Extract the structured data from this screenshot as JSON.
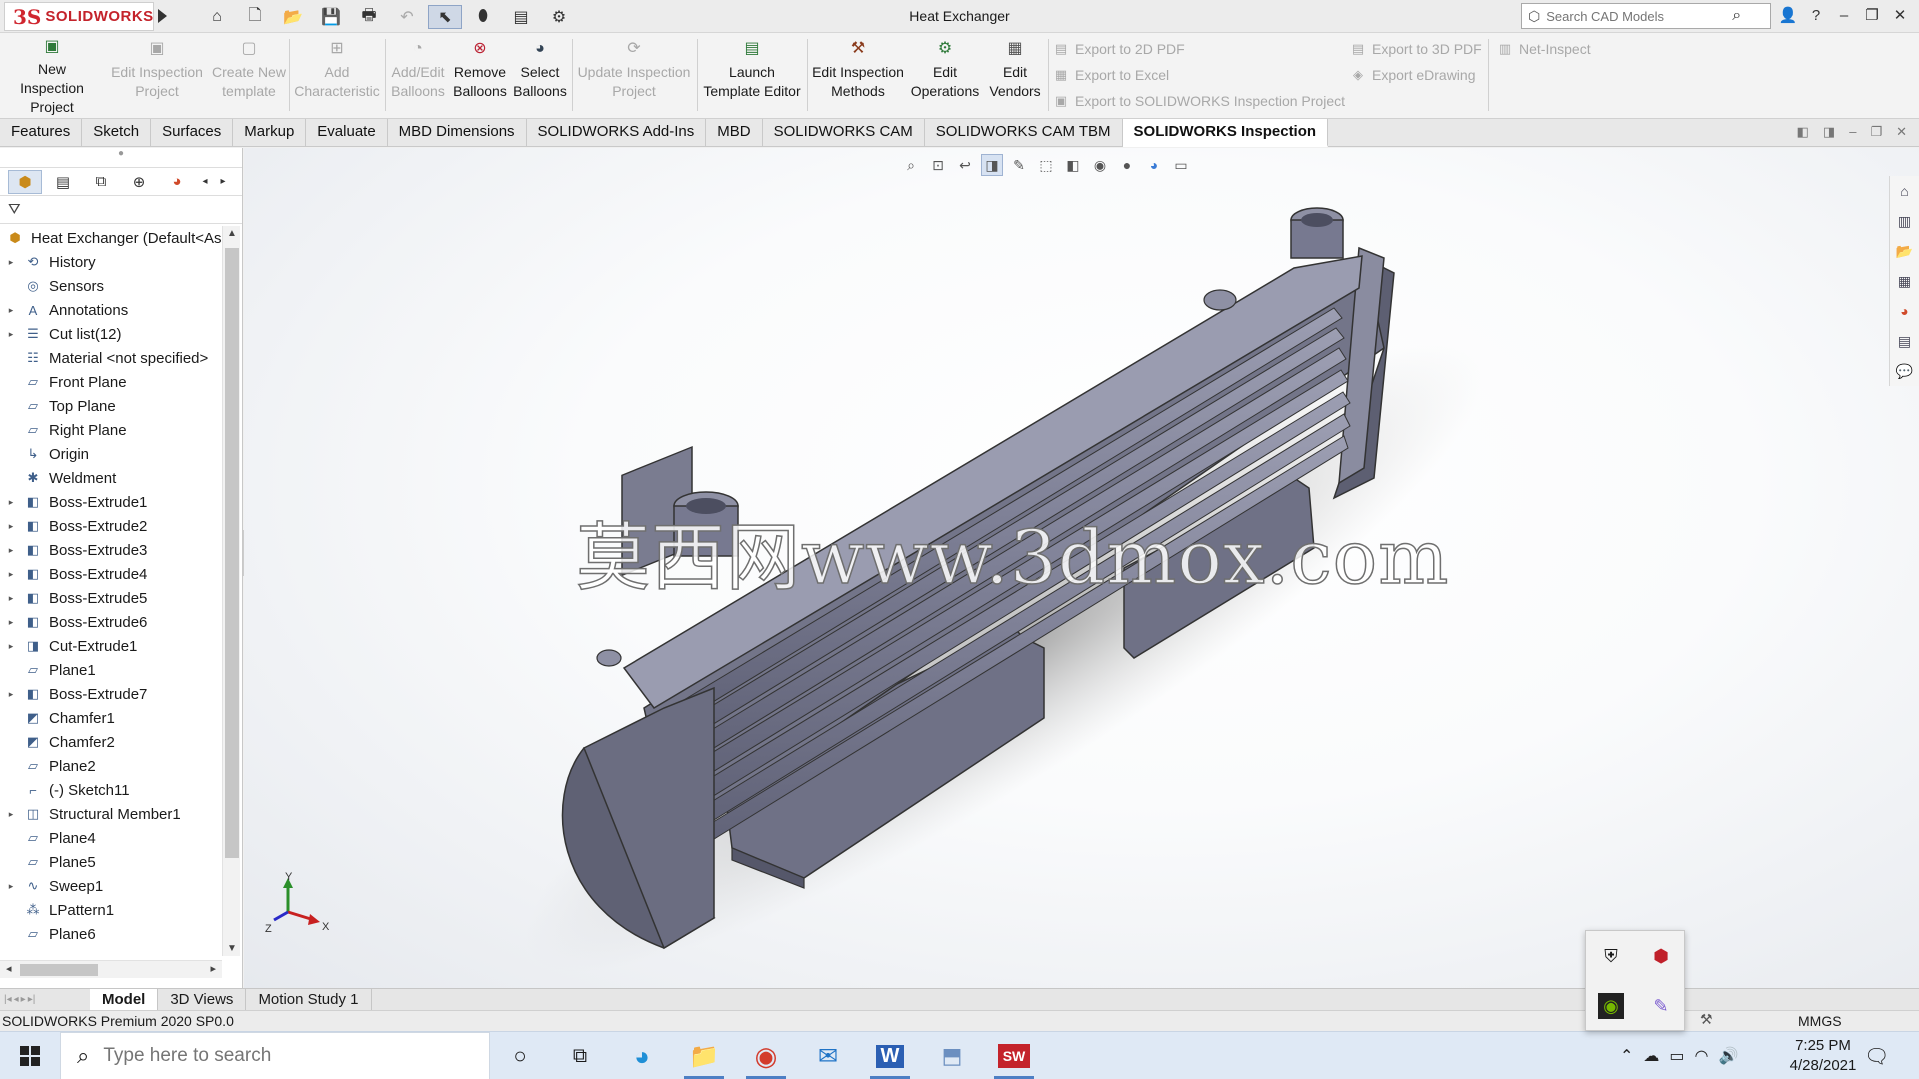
{
  "window": {
    "title": "Heat Exchanger",
    "logo_text": "SOLIDWORKS",
    "search_placeholder": "Search CAD Models"
  },
  "ribbon": {
    "buttons": [
      {
        "label1": "New Inspection",
        "label2": "Project",
        "enabled": true
      },
      {
        "label1": "Edit Inspection",
        "label2": "Project",
        "enabled": false
      },
      {
        "label1": "Create New",
        "label2": "template",
        "enabled": false
      },
      {
        "label1": "Add",
        "label2": "Characteristic",
        "enabled": false
      },
      {
        "label1": "Add/Edit",
        "label2": "Balloons",
        "enabled": false
      },
      {
        "label1": "Remove",
        "label2": "Balloons",
        "enabled": true
      },
      {
        "label1": "Select",
        "label2": "Balloons",
        "enabled": true
      },
      {
        "label1": "Update Inspection",
        "label2": "Project",
        "enabled": false
      },
      {
        "label1": "Launch",
        "label2": "Template Editor",
        "enabled": true
      },
      {
        "label1": "Edit Inspection",
        "label2": "Methods",
        "enabled": true
      },
      {
        "label1": "Edit",
        "label2": "Operations",
        "enabled": true
      },
      {
        "label1": "Edit",
        "label2": "Vendors",
        "enabled": true
      }
    ],
    "exports": [
      "Export to 2D PDF",
      "Export to Excel",
      "Export to SOLIDWORKS Inspection Project",
      "Export to 3D PDF",
      "Export eDrawing",
      "Net-Inspect"
    ]
  },
  "command_tabs": [
    "Features",
    "Sketch",
    "Surfaces",
    "Markup",
    "Evaluate",
    "MBD Dimensions",
    "SOLIDWORKS Add-Ins",
    "MBD",
    "SOLIDWORKS CAM",
    "SOLIDWORKS CAM TBM",
    "SOLIDWORKS Inspection"
  ],
  "active_command_tab": "SOLIDWORKS Inspection",
  "feature_tree": {
    "root": "Heat Exchanger  (Default<As",
    "nodes": [
      {
        "label": "History",
        "expandable": true,
        "icon": "history-icon"
      },
      {
        "label": "Sensors",
        "expandable": false,
        "icon": "sensor-icon"
      },
      {
        "label": "Annotations",
        "expandable": true,
        "icon": "annotation-icon"
      },
      {
        "label": "Cut list(12)",
        "expandable": true,
        "icon": "cutlist-icon"
      },
      {
        "label": "Material <not specified>",
        "expandable": false,
        "icon": "material-icon"
      },
      {
        "label": "Front Plane",
        "expandable": false,
        "icon": "plane-icon"
      },
      {
        "label": "Top Plane",
        "expandable": false,
        "icon": "plane-icon"
      },
      {
        "label": "Right Plane",
        "expandable": false,
        "icon": "plane-icon"
      },
      {
        "label": "Origin",
        "expandable": false,
        "icon": "origin-icon"
      },
      {
        "label": "Weldment",
        "expandable": false,
        "icon": "weldment-icon"
      },
      {
        "label": "Boss-Extrude1",
        "expandable": true,
        "icon": "extrude-icon"
      },
      {
        "label": "Boss-Extrude2",
        "expandable": true,
        "icon": "extrude-icon"
      },
      {
        "label": "Boss-Extrude3",
        "expandable": true,
        "icon": "extrude-icon"
      },
      {
        "label": "Boss-Extrude4",
        "expandable": true,
        "icon": "extrude-icon"
      },
      {
        "label": "Boss-Extrude5",
        "expandable": true,
        "icon": "extrude-icon"
      },
      {
        "label": "Boss-Extrude6",
        "expandable": true,
        "icon": "extrude-icon"
      },
      {
        "label": "Cut-Extrude1",
        "expandable": true,
        "icon": "cut-extrude-icon"
      },
      {
        "label": "Plane1",
        "expandable": false,
        "icon": "plane-icon"
      },
      {
        "label": "Boss-Extrude7",
        "expandable": true,
        "icon": "extrude-icon"
      },
      {
        "label": "Chamfer1",
        "expandable": false,
        "icon": "chamfer-icon"
      },
      {
        "label": "Chamfer2",
        "expandable": false,
        "icon": "chamfer-icon"
      },
      {
        "label": "Plane2",
        "expandable": false,
        "icon": "plane-icon"
      },
      {
        "label": "(-) Sketch11",
        "expandable": false,
        "icon": "sketch-icon"
      },
      {
        "label": "Structural Member1",
        "expandable": true,
        "icon": "structural-member-icon"
      },
      {
        "label": "Plane4",
        "expandable": false,
        "icon": "plane-icon"
      },
      {
        "label": "Plane5",
        "expandable": false,
        "icon": "plane-icon"
      },
      {
        "label": "Sweep1",
        "expandable": true,
        "icon": "sweep-icon"
      },
      {
        "label": "LPattern1",
        "expandable": false,
        "icon": "pattern-icon"
      },
      {
        "label": "Plane6",
        "expandable": false,
        "icon": "plane-icon"
      }
    ]
  },
  "watermark": "莫西网www.3dmox.com",
  "triad": {
    "x": "X",
    "y": "Y",
    "z": "Z"
  },
  "bottom_tabs": [
    "Model",
    "3D Views",
    "Motion Study 1"
  ],
  "active_bottom_tab": "Model",
  "status": {
    "text": "SOLIDWORKS Premium 2020 SP0.0",
    "units": "MMGS"
  },
  "taskbar": {
    "search_placeholder": "Type here to search",
    "time": "7:25 PM",
    "date": "4/28/2021"
  },
  "colors": {
    "brand": "#d0262f",
    "model": "#7b7d91",
    "taskbar": "#dfe9f5"
  }
}
